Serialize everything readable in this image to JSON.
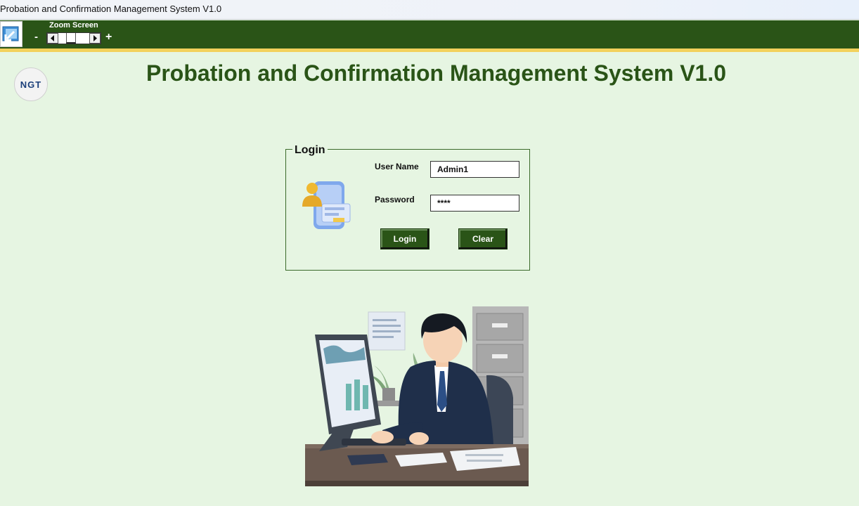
{
  "window": {
    "title": "Probation and Confirmation Management System V1.0"
  },
  "toolbar": {
    "zoom_label": "Zoom Screen",
    "zoom_minus": "-",
    "zoom_plus": "+",
    "zoom_level": 0.35
  },
  "logo": {
    "text": "NGT"
  },
  "page": {
    "title": "Probation and Confirmation Management System V1.0"
  },
  "login": {
    "legend": "Login",
    "username_label": "User Name",
    "username_value": "Admin1",
    "password_label": "Password",
    "password_value": "****",
    "login_button": "Login",
    "clear_button": "Clear"
  },
  "icons": [
    "back-arrow-icon",
    "user-card-icon",
    "office-worker-illustration"
  ],
  "colors": {
    "brand_green": "#2a5417",
    "accent_yellow": "#f2d15c",
    "background": "#e6f5e2"
  }
}
